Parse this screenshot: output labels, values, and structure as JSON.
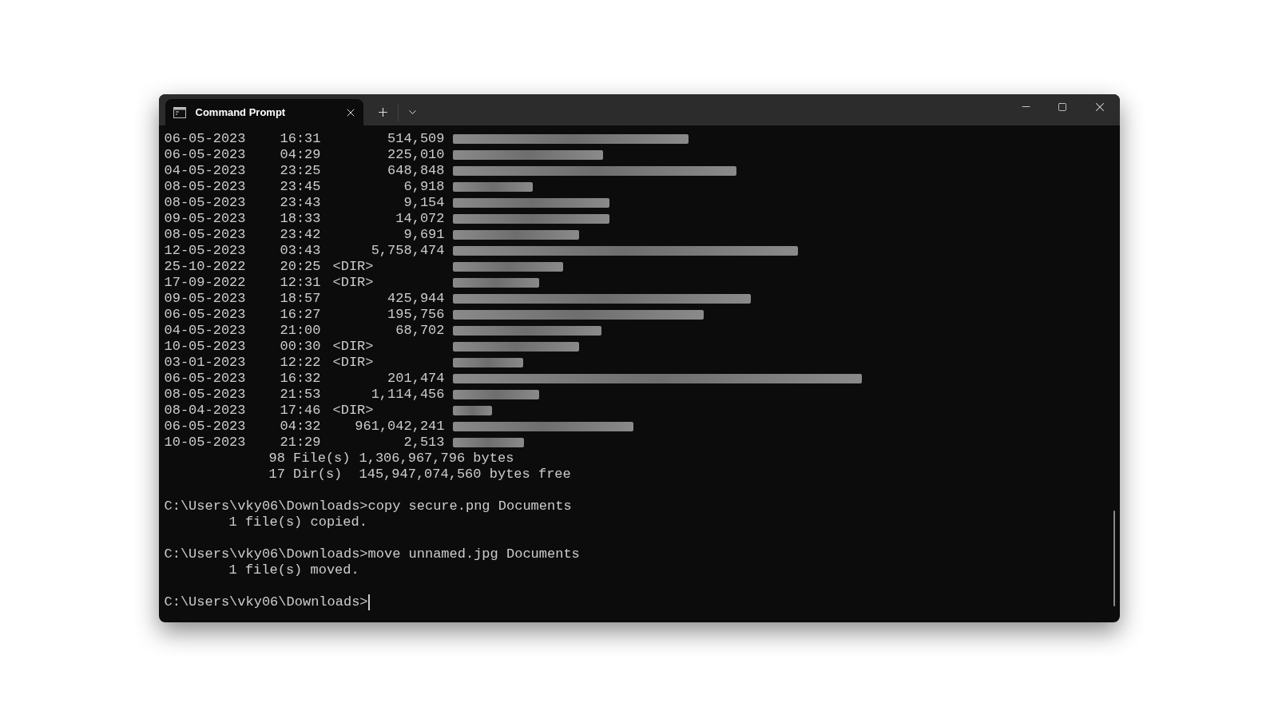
{
  "tab": {
    "title": "Command Prompt",
    "selected": true
  },
  "listing": [
    {
      "date": "06-05-2023",
      "time": "16:31",
      "kind": "file",
      "size": "514,509",
      "redacted": true
    },
    {
      "date": "06-05-2023",
      "time": "04:29",
      "kind": "file",
      "size": "225,010",
      "redacted": true
    },
    {
      "date": "04-05-2023",
      "time": "23:25",
      "kind": "file",
      "size": "648,848",
      "redacted": true
    },
    {
      "date": "08-05-2023",
      "time": "23:45",
      "kind": "file",
      "size": "6,918",
      "redacted": true
    },
    {
      "date": "08-05-2023",
      "time": "23:43",
      "kind": "file",
      "size": "9,154",
      "redacted": true
    },
    {
      "date": "09-05-2023",
      "time": "18:33",
      "kind": "file",
      "size": "14,072",
      "redacted": true
    },
    {
      "date": "08-05-2023",
      "time": "23:42",
      "kind": "file",
      "size": "9,691",
      "redacted": true
    },
    {
      "date": "12-05-2023",
      "time": "03:43",
      "kind": "file",
      "size": "5,758,474",
      "redacted": true
    },
    {
      "date": "25-10-2022",
      "time": "20:25",
      "kind": "dir",
      "size": "<DIR>",
      "redacted": true
    },
    {
      "date": "17-09-2022",
      "time": "12:31",
      "kind": "dir",
      "size": "<DIR>",
      "redacted": true
    },
    {
      "date": "09-05-2023",
      "time": "18:57",
      "kind": "file",
      "size": "425,944",
      "redacted": true
    },
    {
      "date": "06-05-2023",
      "time": "16:27",
      "kind": "file",
      "size": "195,756",
      "redacted": true
    },
    {
      "date": "04-05-2023",
      "time": "21:00",
      "kind": "file",
      "size": "68,702",
      "redacted": true
    },
    {
      "date": "10-05-2023",
      "time": "00:30",
      "kind": "dir",
      "size": "<DIR>",
      "redacted": true
    },
    {
      "date": "03-01-2023",
      "time": "12:22",
      "kind": "dir",
      "size": "<DIR>",
      "redacted": true
    },
    {
      "date": "06-05-2023",
      "time": "16:32",
      "kind": "file",
      "size": "201,474",
      "redacted": true
    },
    {
      "date": "08-05-2023",
      "time": "21:53",
      "kind": "file",
      "size": "1,114,456",
      "redacted": true
    },
    {
      "date": "08-04-2023",
      "time": "17:46",
      "kind": "dir",
      "size": "<DIR>",
      "redacted": true
    },
    {
      "date": "06-05-2023",
      "time": "04:32",
      "kind": "file",
      "size": "961,042,241",
      "redacted": true
    },
    {
      "date": "10-05-2023",
      "time": "21:29",
      "kind": "file",
      "size": "2,513",
      "redacted": true
    }
  ],
  "summary": [
    {
      "count": "98 File(s)",
      "amount": "1,306,967,796 bytes"
    },
    {
      "count": "17 Dir(s)",
      "amount": "145,947,074,560 bytes free"
    }
  ],
  "session": [
    {
      "prompt": "C:\\Users\\vky06\\Downloads>",
      "command": "copy secure.png Documents",
      "output": "1 file(s) copied.",
      "cursor": false
    },
    {
      "prompt": "C:\\Users\\vky06\\Downloads>",
      "command": "move unnamed.jpg Documents",
      "output": "1 file(s) moved.",
      "cursor": false
    },
    {
      "prompt": "C:\\Users\\vky06\\Downloads>",
      "cursor": true
    }
  ]
}
